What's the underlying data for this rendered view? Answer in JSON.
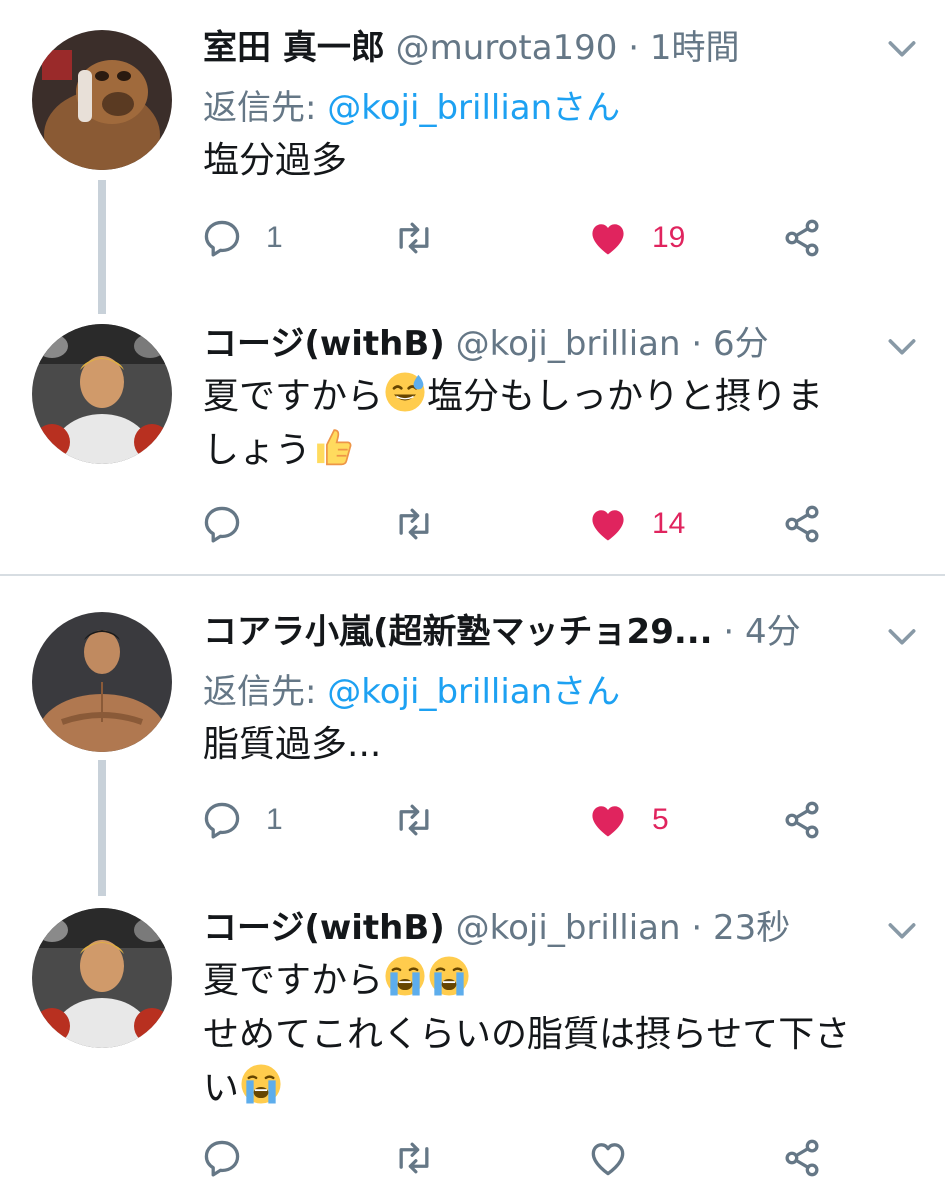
{
  "colors": {
    "link": "#1da1f2",
    "like": "#e0245e",
    "muted": "#657786",
    "thread": "#c8d1d9"
  },
  "tweets": [
    {
      "name": "室田 真一郎",
      "handle": "@murota190",
      "time": "1時間",
      "reply_prefix": "返信先: ",
      "reply_handle": "@koji_brillianさん",
      "body_lines": [
        "塩分過多"
      ],
      "reply_count": "1",
      "like_count": "19",
      "liked": true,
      "avatar_icon": "alf-avatar-icon"
    },
    {
      "name": "コージ(withB)",
      "handle": "@koji_brillian",
      "time": "6分",
      "body_lines": [
        "夏ですから",
        "塩分もしっかりと摂りま",
        "しょう"
      ],
      "reply_count": "",
      "like_count": "14",
      "liked": true,
      "avatar_icon": "koji-avatar-icon"
    },
    {
      "name": "コアラ小嵐(超新塾マッチョ29...",
      "handle": "",
      "time": "4分",
      "reply_prefix": "返信先: ",
      "reply_handle": "@koji_brillianさん",
      "body_lines": [
        "脂質過多..."
      ],
      "reply_count": "1",
      "like_count": "5",
      "liked": true,
      "avatar_icon": "muscle-man-avatar-icon"
    },
    {
      "name": "コージ(withB)",
      "handle": "@koji_brillian",
      "time": "23秒",
      "body_lines": [
        "夏ですから",
        "せめてこれくらいの脂質は摂らせて下さ",
        "い"
      ],
      "reply_count": "",
      "like_count": "",
      "liked": false,
      "avatar_icon": "koji-avatar-icon"
    }
  ],
  "separator": " · "
}
